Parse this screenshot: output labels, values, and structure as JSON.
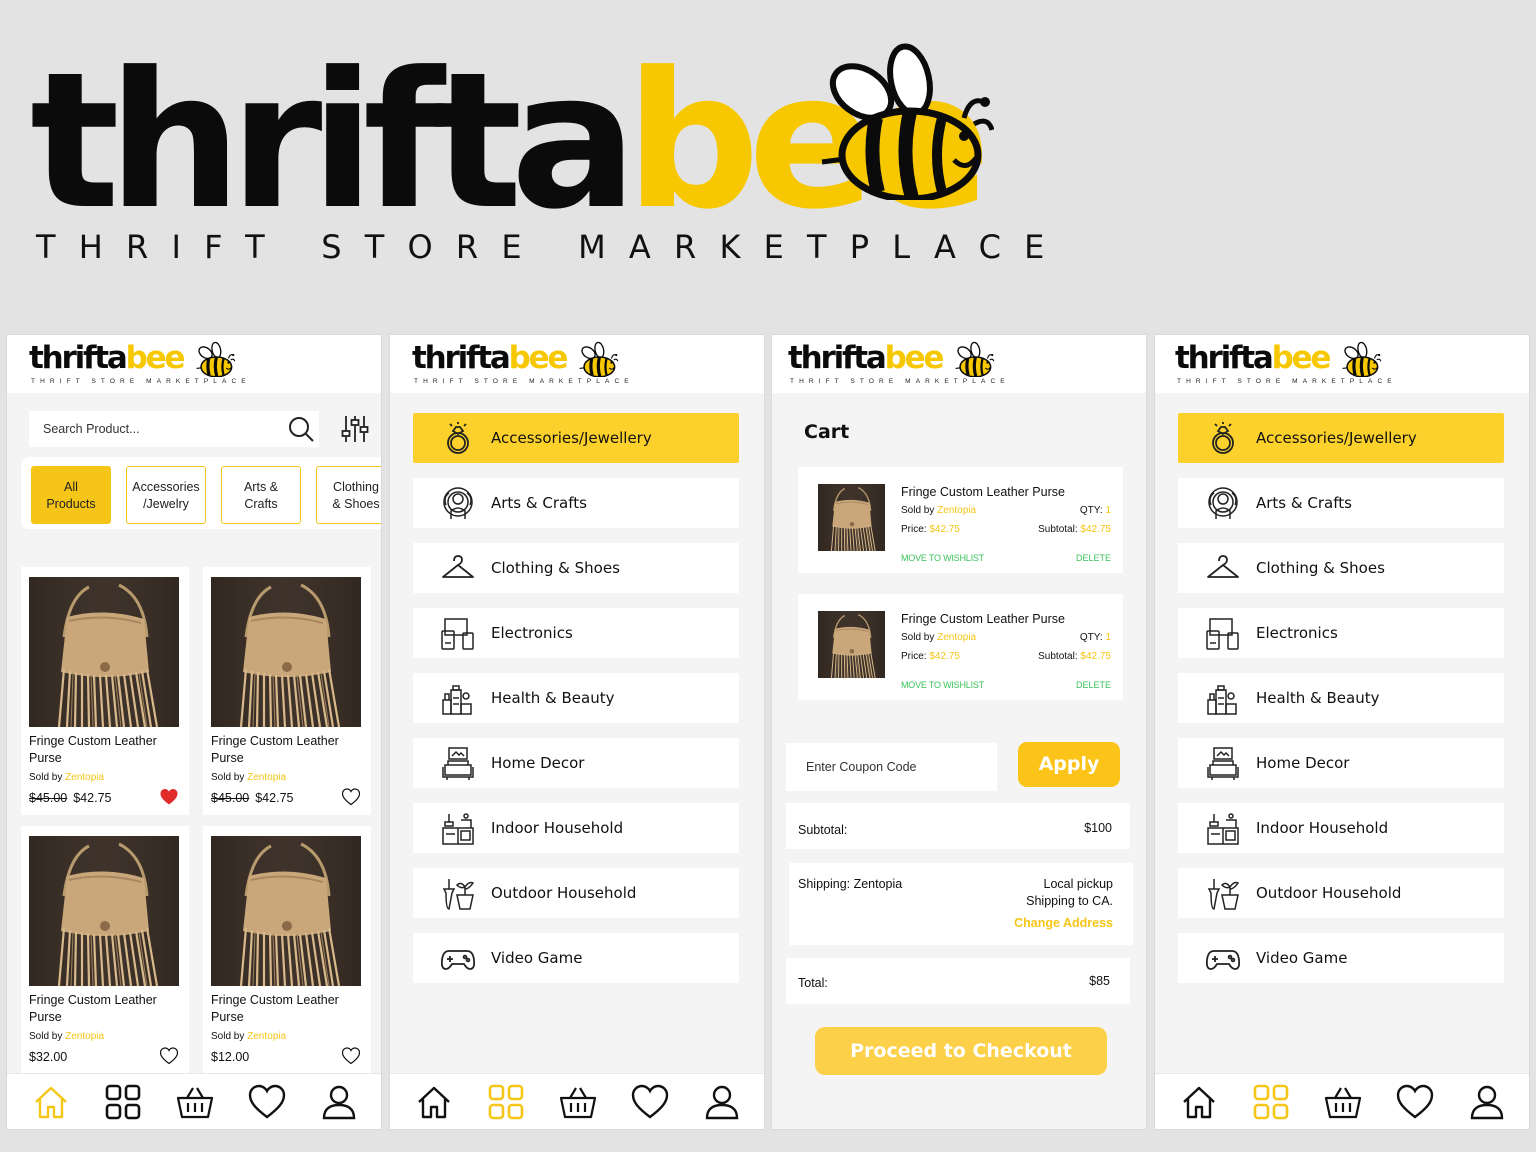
{
  "brand": {
    "name_dark": "thrifta",
    "name_yellow": "bee",
    "tagline": "THRIFT STORE MARKETPLACE",
    "colors": {
      "yellow": "#f7c800",
      "dark": "#0b0b0b",
      "accent_green": "#3bc25c"
    }
  },
  "products_screen": {
    "search": {
      "placeholder": "Search Product..."
    },
    "chips": [
      {
        "label": "All\nProducts",
        "active": true
      },
      {
        "label": "Accessories\n/Jewelry",
        "active": false
      },
      {
        "label": "Arts &\nCrafts",
        "active": false
      },
      {
        "label": "Clothing\n& Shoes",
        "active": false
      }
    ],
    "products": [
      {
        "name": "Fringe Custom Leather Purse",
        "sold_by_label": "Sold by",
        "seller": "Zentopia",
        "old_price": "$45.00",
        "price": "$42.75",
        "favorited": true
      },
      {
        "name": "Fringe Custom Leather Purse",
        "sold_by_label": "Sold by",
        "seller": "Zentopia",
        "old_price": "$45.00",
        "price": "$42.75",
        "favorited": false
      },
      {
        "name": "Fringe Custom Leather Purse",
        "sold_by_label": "Sold by",
        "seller": "Zentopia",
        "old_price": "",
        "price": "$32.00",
        "favorited": false
      },
      {
        "name": "Fringe Custom Leather Purse",
        "sold_by_label": "Sold by",
        "seller": "Zentopia",
        "old_price": "",
        "price": "$12.00",
        "favorited": false
      }
    ]
  },
  "categories": [
    {
      "label": "Accessories/Jewellery",
      "icon": "ring-icon",
      "active": true
    },
    {
      "label": "Arts & Crafts",
      "icon": "arts-crafts-icon",
      "active": false
    },
    {
      "label": "Clothing & Shoes",
      "icon": "hanger-icon",
      "active": false
    },
    {
      "label": "Electronics",
      "icon": "devices-icon",
      "active": false
    },
    {
      "label": "Health & Beauty",
      "icon": "cosmetics-icon",
      "active": false
    },
    {
      "label": "Home Decor",
      "icon": "sofa-icon",
      "active": false
    },
    {
      "label": "Indoor Household",
      "icon": "kitchen-icon",
      "active": false
    },
    {
      "label": "Outdoor Household",
      "icon": "plant-icon",
      "active": false
    },
    {
      "label": "Video Game",
      "icon": "gamepad-icon",
      "active": false
    }
  ],
  "cart": {
    "title": "Cart",
    "items": [
      {
        "name": "Fringe Custom Leather Purse",
        "sold_by_label": "Sold by",
        "seller": "Zentopia",
        "qty_label": "QTY:",
        "qty": "1",
        "price_label": "Price:",
        "price": "$42.75",
        "subtotal_label": "Subtotal:",
        "subtotal": "$42.75",
        "wishlist": "MOVE TO WISHLIST",
        "delete": "DELETE"
      },
      {
        "name": "Fringe Custom Leather Purse",
        "sold_by_label": "Sold by",
        "seller": "Zentopia",
        "qty_label": "QTY:",
        "qty": "1",
        "price_label": "Price:",
        "price": "$42.75",
        "subtotal_label": "Subtotal:",
        "subtotal": "$42.75",
        "wishlist": "MOVE TO WISHLIST",
        "delete": "DELETE"
      }
    ],
    "coupon_placeholder": "Enter Coupon Code",
    "apply": "Apply",
    "subtotal_label": "Subtotal:",
    "subtotal": "$100",
    "shipping_label": "Shipping: Zentopia",
    "shipping_line1": "Local pickup",
    "shipping_line2": "Shipping to CA.",
    "change_address": "Change Address",
    "total_label": "Total:",
    "total": "$85",
    "checkout": "Proceed to Checkout"
  },
  "nav": {
    "items": [
      "home-icon",
      "grid-icon",
      "basket-icon",
      "heart-icon",
      "user-icon"
    ],
    "active_by_screen": [
      "home-icon",
      "grid-icon",
      "none",
      "grid-icon"
    ]
  }
}
